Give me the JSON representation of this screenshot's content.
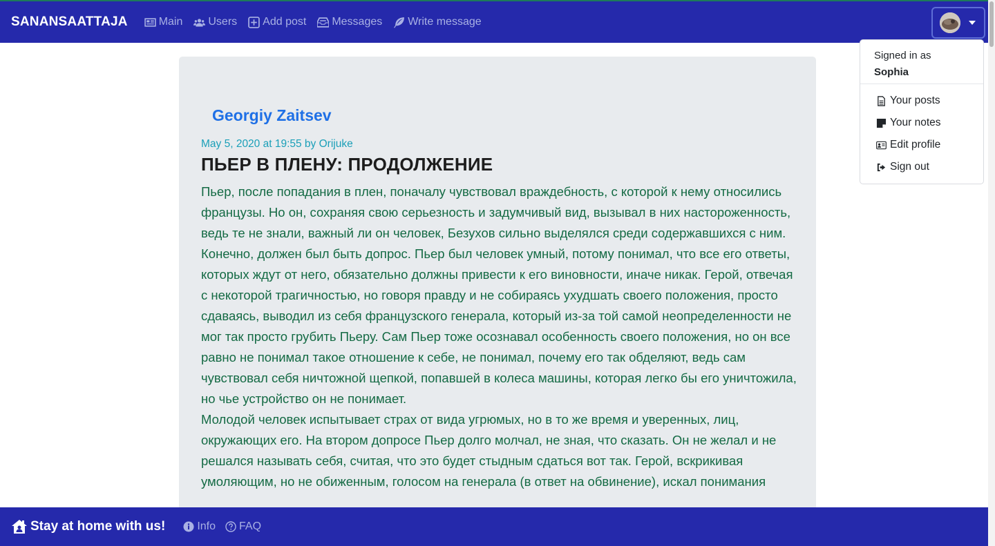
{
  "navbar": {
    "brand": "SANANSAATTAJA",
    "links": [
      {
        "label": "Main",
        "icon": "newspaper-icon"
      },
      {
        "label": "Users",
        "icon": "users-icon"
      },
      {
        "label": "Add post",
        "icon": "plus-square-icon"
      },
      {
        "label": "Messages",
        "icon": "inbox-icon"
      },
      {
        "label": "Write message",
        "icon": "feather-icon"
      }
    ],
    "avatar_icon": "user-avatar"
  },
  "dropdown": {
    "signed_in_as": "Signed in as",
    "username": "Sophia",
    "items": [
      {
        "label": "Your posts",
        "icon": "file-icon"
      },
      {
        "label": "Your notes",
        "icon": "sticky-note-icon"
      },
      {
        "label": "Edit profile",
        "icon": "id-card-icon"
      },
      {
        "label": "Sign out",
        "icon": "sign-out-icon"
      }
    ]
  },
  "post": {
    "author": "Georgiy Zaitsev",
    "meta": "May 5, 2020 at 19:55 by Orijuke",
    "title": "ПЬЕР В ПЛЕНУ: ПРОДОЛЖЕНИЕ",
    "paragraphs": [
      "Пьер, после попадания в плен, поначалу чувствовал враждебность, с которой к нему относились французы. Но он, сохраняя свою серьезность и задумчивый вид, вызывал в них настороженность, ведь те не знали, важный ли он человек, Безухов сильно выделялся среди содержавшихся с ним. Конечно, должен был быть допрос. Пьер был человек умный, потому понимал, что все его ответы, которых ждут от него, обязательно должны привести к его виновности, иначе никак. Герой, отвечая с некоторой трагичностью, но говоря правду и не собираясь ухудшать своего положения, просто сдаваясь, выводил из себя французского генерала, который из-за той самой неопределенности не мог так просто грубить Пьеру. Сам Пьер тоже осознавал особенность своего положения, но он все равно не понимал такое отношение к себе, не понимал, почему его так обделяют, ведь сам чувствовал себя ничтожной щепкой, попавшей в колеса машины, которая легко бы его уничтожила, но чье устройство он не понимает.",
      "Молодой человек испытывает страх от вида угрюмых, но в то же время и уверенных, лиц, окружающих его. На втором допросе Пьер долго молчал, не зная, что сказать. Он не желал и не решался называть себя, считая, что это будет стыдным сдаться вот так. Герой, вскрикивая умоляющим, но не обиженным, голосом на генерала (в ответ на обвинение), искал понимания"
    ]
  },
  "footer": {
    "brand": "Stay at home with us!",
    "brand_icon": "house-user-icon",
    "links": [
      {
        "label": "Info",
        "icon": "info-circle-icon"
      },
      {
        "label": "FAQ",
        "icon": "question-circle-icon"
      }
    ]
  },
  "colors": {
    "navbar_bg": "#2529ab",
    "nav_link": "#a9b1e4",
    "card_bg": "#e8ebee",
    "author": "#1f70e6",
    "meta": "#1a9fb8",
    "body_text": "#146a44"
  }
}
